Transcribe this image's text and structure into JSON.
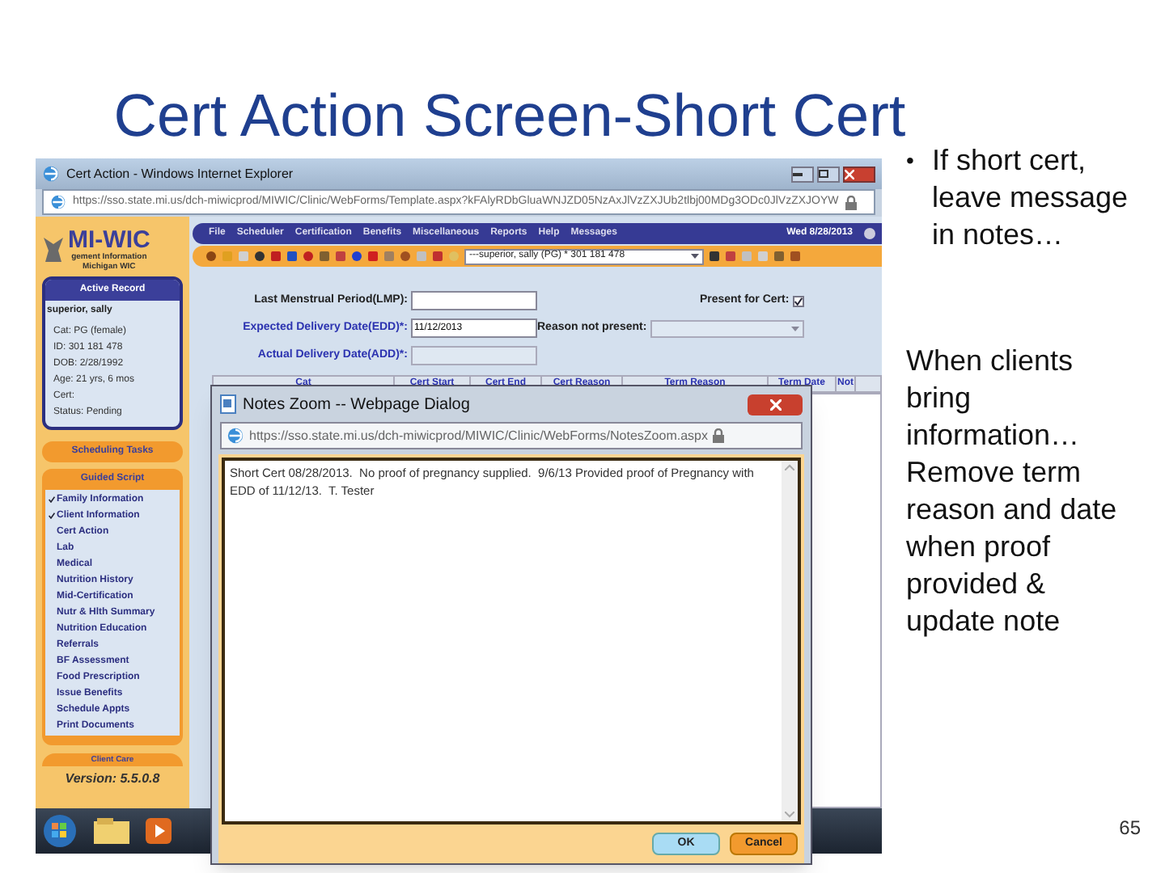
{
  "slide": {
    "title": "Cert Action Screen-Short Cert",
    "page_number": "65",
    "bullets": [
      {
        "bullet": "•",
        "text": "If short cert, leave message in notes…"
      },
      {
        "text": "When clients bring information… Remove term reason and date when proof provided & update note"
      }
    ]
  },
  "browser": {
    "title": "Cert Action - Windows Internet Explorer",
    "url": "https://sso.state.mi.us/dch-miwicprod/MIWIC/Clinic/WebForms/Template.aspx?kFAlyRDbGluaWNJZD05NzAxJlVzZXJUb2tlbj00MDg3ODc0JlVzZXJOYW"
  },
  "sidebar": {
    "logo": "MI-WIC",
    "logo_lines": [
      "gement Information",
      "Michigan WIC"
    ],
    "active_record": {
      "title": "Active Record",
      "name": "superior, sally",
      "fields": [
        "Cat: PG (female)",
        "ID: 301 181 478",
        "DOB: 2/28/1992",
        "Age: 21 yrs, 6 mos",
        "Cert:",
        "Status: Pending"
      ]
    },
    "scheduling_tasks": "Scheduling Tasks",
    "guided_script": {
      "title": "Guided Script",
      "items": [
        {
          "label": "Family Information",
          "checked": true
        },
        {
          "label": "Client Information",
          "checked": true
        },
        {
          "label": "Cert Action",
          "checked": false
        },
        {
          "label": "Lab",
          "checked": false
        },
        {
          "label": "Medical",
          "checked": false
        },
        {
          "label": "Nutrition History",
          "checked": false
        },
        {
          "label": "Mid-Certification",
          "checked": false
        },
        {
          "label": "Nutr & Hlth Summary",
          "checked": false
        },
        {
          "label": "Nutrition Education",
          "checked": false
        },
        {
          "label": "Referrals",
          "checked": false
        },
        {
          "label": "BF Assessment",
          "checked": false
        },
        {
          "label": "Food Prescription",
          "checked": false
        },
        {
          "label": "Issue Benefits",
          "checked": false
        },
        {
          "label": "Schedule Appts",
          "checked": false
        },
        {
          "label": "Print Documents",
          "checked": false
        }
      ]
    },
    "client_care": "Client Care",
    "version": "Version: 5.5.0.8"
  },
  "menu": [
    "File",
    "Scheduler",
    "Certification",
    "Benefits",
    "Miscellaneous",
    "Reports",
    "Help",
    "Messages"
  ],
  "date": "Wed 8/28/2013",
  "client_select": "---superior, sally (PG) * 301 181 478",
  "form": {
    "lmp_label": "Last Menstrual Period(LMP):",
    "edd_label": "Expected Delivery Date(EDD)*:",
    "edd_value": "11/12/2013",
    "add_label": "Actual Delivery Date(ADD)*:",
    "present_label": "Present for Cert:",
    "present_checked": true,
    "reason_label": "Reason not present:"
  },
  "table": {
    "columns": [
      "Cat",
      "Cert Start",
      "Cert End",
      "Cert Reason",
      "Term Reason",
      "Term Date",
      "Not"
    ]
  },
  "dialog": {
    "title": "Notes Zoom -- Webpage Dialog",
    "url": "https://sso.state.mi.us/dch-miwicprod/MIWIC/Clinic/WebForms/NotesZoom.aspx",
    "note": "Short Cert 08/28/2013.  No proof of pregnancy supplied.  9/6/13 Provided proof of Pregnancy with EDD of 11/12/13.  T. Tester",
    "buttons": [
      "OK",
      "Cancel"
    ]
  }
}
